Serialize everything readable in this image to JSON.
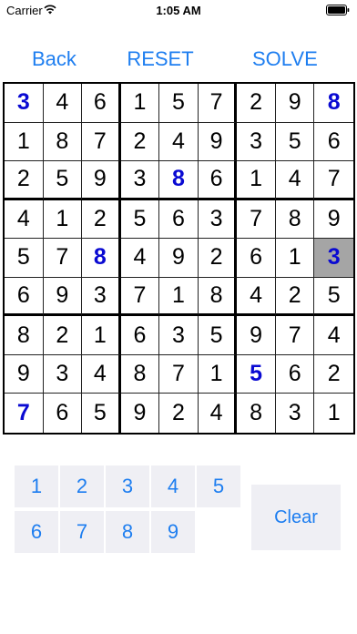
{
  "status_bar": {
    "carrier": "Carrier",
    "time": "1:05 AM"
  },
  "nav": {
    "back": "Back",
    "reset": "RESET",
    "solve": "SOLVE"
  },
  "board": {
    "rows": [
      [
        "3",
        "4",
        "6",
        "1",
        "5",
        "7",
        "2",
        "9",
        "8"
      ],
      [
        "1",
        "8",
        "7",
        "2",
        "4",
        "9",
        "3",
        "5",
        "6"
      ],
      [
        "2",
        "5",
        "9",
        "3",
        "8",
        "6",
        "1",
        "4",
        "7"
      ],
      [
        "4",
        "1",
        "2",
        "5",
        "6",
        "3",
        "7",
        "8",
        "9"
      ],
      [
        "5",
        "7",
        "8",
        "4",
        "9",
        "2",
        "6",
        "1",
        "3"
      ],
      [
        "6",
        "9",
        "3",
        "7",
        "1",
        "8",
        "4",
        "2",
        "5"
      ],
      [
        "8",
        "2",
        "1",
        "6",
        "3",
        "5",
        "9",
        "7",
        "4"
      ],
      [
        "9",
        "3",
        "4",
        "8",
        "7",
        "1",
        "5",
        "6",
        "2"
      ],
      [
        "7",
        "6",
        "5",
        "9",
        "2",
        "4",
        "8",
        "3",
        "1"
      ]
    ],
    "highlighted_cells": [
      [
        0,
        0
      ],
      [
        0,
        8
      ],
      [
        2,
        4
      ],
      [
        4,
        2
      ],
      [
        4,
        8
      ],
      [
        7,
        6
      ],
      [
        8,
        0
      ]
    ],
    "selected_cell": [
      4,
      8
    ]
  },
  "keypad": {
    "digits": [
      "1",
      "2",
      "3",
      "4",
      "5",
      "6",
      "7",
      "8",
      "9"
    ],
    "clear": "Clear"
  },
  "colors": {
    "accent": "#1e7ef0",
    "given_digit": "#0a0ad2",
    "selected_bg": "#a5a5a5",
    "key_bg": "#efeff4"
  }
}
